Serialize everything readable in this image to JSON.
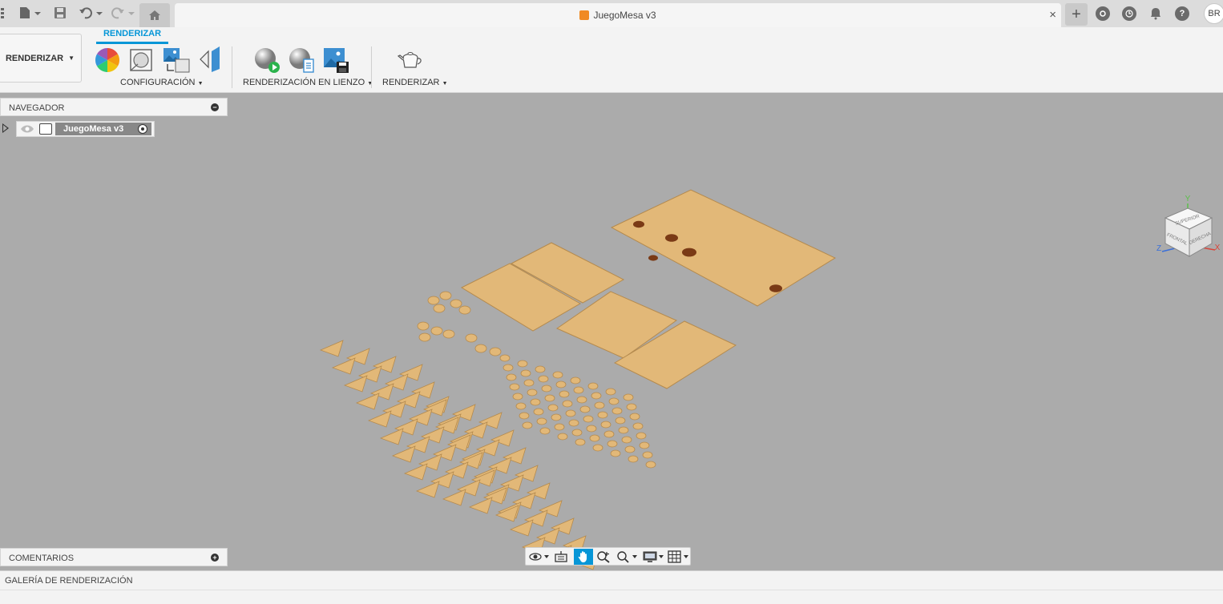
{
  "titlebar": {
    "document_title": "JuegoMesa v3",
    "close_symbol": "×",
    "new_tab_symbol": "+",
    "user_initials": "BR",
    "icons": [
      "grid-menu-icon",
      "file-icon",
      "save-icon",
      "undo-icon",
      "redo-icon",
      "home-icon",
      "extensions-icon",
      "job-status-icon",
      "notifications-icon",
      "help-icon"
    ]
  },
  "toolbar": {
    "workspace_label": "RENDERIZAR",
    "active_tab": "RENDERIZAR",
    "groups": [
      {
        "label": "CONFIGURACIÓN",
        "icons": [
          "appearance-icon",
          "scene-settings-icon",
          "texture-map-icon",
          "decal-icon"
        ]
      },
      {
        "label": "RENDERIZACIÓN EN LIENZO",
        "icons": [
          "in-canvas-render-icon",
          "in-canvas-settings-icon",
          "capture-image-icon"
        ]
      },
      {
        "label": "RENDERIZAR",
        "icons": [
          "render-teapot-icon"
        ]
      }
    ]
  },
  "browser": {
    "title": "NAVEGADOR",
    "root_label": "JuegoMesa v3"
  },
  "comments": {
    "title": "COMENTARIOS"
  },
  "gallery": {
    "title": "GALERÍA DE RENDERIZACIÓN"
  },
  "viewcube": {
    "faces": [
      "SUPERIOR",
      "FRONTAL",
      "DERECHA"
    ],
    "axes": {
      "y": "Y",
      "z": "Z",
      "x": "X"
    },
    "axis_colors": {
      "x": "#d9453a",
      "y": "#5bbf4a",
      "z": "#3a6fd9"
    }
  },
  "navbar": {
    "icons": [
      "orbit-icon",
      "look-at-icon",
      "pan-icon",
      "zoom-icon",
      "fit-icon",
      "display-settings-icon",
      "grid-settings-icon"
    ],
    "active": "pan-icon"
  },
  "colors": {
    "accent": "#0696d7",
    "viewport": "#ababab",
    "wood": "#e2b878"
  }
}
